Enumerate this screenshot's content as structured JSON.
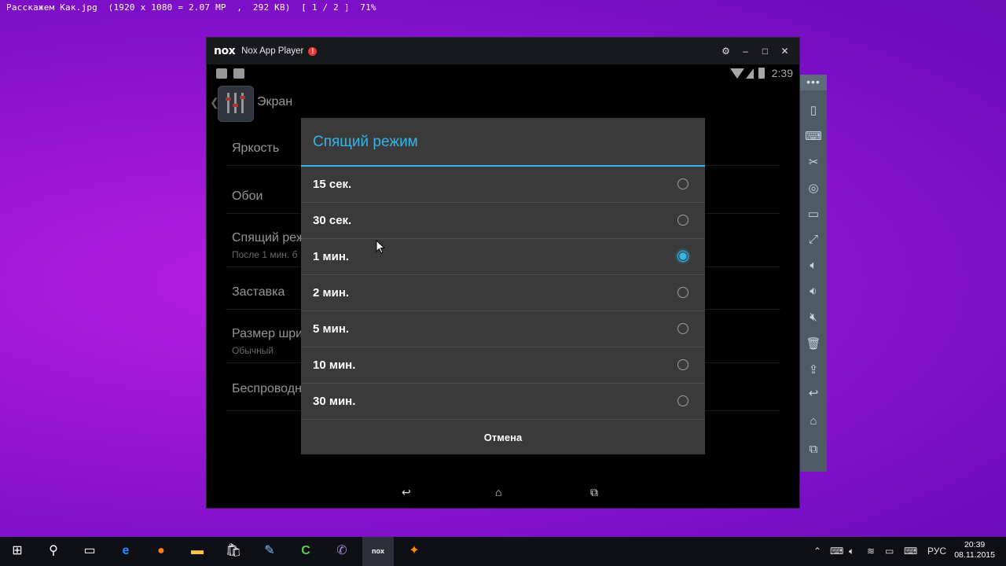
{
  "viewer": {
    "caption": "Расскажем Как.jpg  (1920 x 1080 = 2.07 MP  ,  292 KB)  [ 1 / 2 ]  71%"
  },
  "window": {
    "logo": "nox",
    "title": "Nox App Player",
    "alert_badge": "!",
    "controls": [
      "⚙",
      "–",
      "□",
      "✕"
    ]
  },
  "android": {
    "status_time": "2:39",
    "screen_title": "Экран",
    "settings": [
      {
        "title": "Яркость",
        "subtitle": ""
      },
      {
        "title": "Обои",
        "subtitle": ""
      },
      {
        "title": "Спящий реж",
        "subtitle": "После 1 мин. б"
      },
      {
        "title": "Заставка",
        "subtitle": ""
      },
      {
        "title": "Размер шри",
        "subtitle": "Обычный"
      },
      {
        "title": "Беспроводн",
        "subtitle": ""
      }
    ],
    "dialog": {
      "title": "Спящий режим",
      "options": [
        {
          "label": "15 сек.",
          "selected": false
        },
        {
          "label": "30 сек.",
          "selected": false
        },
        {
          "label": "1 мин.",
          "selected": true
        },
        {
          "label": "2 мин.",
          "selected": false
        },
        {
          "label": "5 мин.",
          "selected": false
        },
        {
          "label": "10 мин.",
          "selected": false
        },
        {
          "label": "30 мин.",
          "selected": false
        }
      ],
      "cancel_label": "Отмена"
    },
    "nav": {
      "back_icon": "back-icon",
      "home_icon": "home-icon",
      "recents_icon": "recents-icon"
    }
  },
  "sidebar": {
    "more": "•••",
    "tools": [
      "shake-icon",
      "keyboard-icon",
      "scissors-icon",
      "location-icon",
      "screenshot-icon",
      "fullscreen-icon",
      "volume-up-icon",
      "volume-down-icon",
      "mute-icon",
      "trash-icon",
      "install-apk-icon",
      "back-icon",
      "home-icon",
      "recents-icon"
    ]
  },
  "taskbar": {
    "apps": [
      "windows-start-icon",
      "search-icon",
      "task-view-icon",
      "edge-icon",
      "firefox-icon",
      "file-explorer-icon",
      "store-icon",
      "paint-icon",
      "camtasia-icon",
      "viber-icon",
      "nox-icon",
      "photo-app-icon"
    ],
    "lang": "РУС",
    "time": "20:39",
    "date": "08.11.2015"
  }
}
